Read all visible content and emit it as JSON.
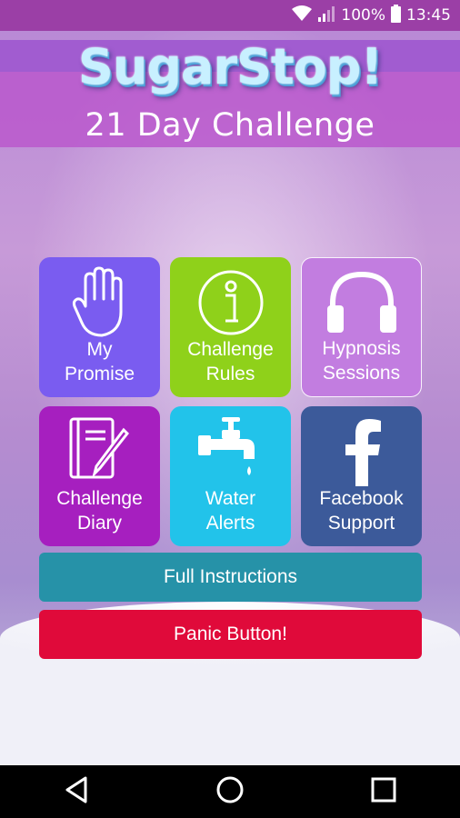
{
  "status_bar": {
    "battery_text": "100%",
    "time": "13:45",
    "bg": "#9b3fa6"
  },
  "header": {
    "logo": "SugarStop!",
    "subtitle": "21 Day Challenge"
  },
  "tiles": [
    {
      "label": "My\nPromise",
      "icon": "raised-hand-icon",
      "color": "#7a5cf0"
    },
    {
      "label": "Challenge\nRules",
      "icon": "info-icon",
      "color": "#8fd11a"
    },
    {
      "label": "Hypnosis\nSessions",
      "icon": "headphones-icon",
      "color": "#c27de0"
    },
    {
      "label": "Challenge\nDiary",
      "icon": "diary-pencil-icon",
      "color": "#a61fbf"
    },
    {
      "label": "Water\nAlerts",
      "icon": "water-tap-icon",
      "color": "#22c3ea"
    },
    {
      "label": "Facebook\nSupport",
      "icon": "facebook-icon",
      "color": "#3c5a9a"
    }
  ],
  "buttons": {
    "instructions": {
      "label": "Full Instructions",
      "color": "#2692a8"
    },
    "panic": {
      "label": "Panic Button!",
      "color": "#e00a3a"
    }
  },
  "nav": {
    "back": "back-icon",
    "home": "home-icon",
    "recents": "recents-icon"
  }
}
